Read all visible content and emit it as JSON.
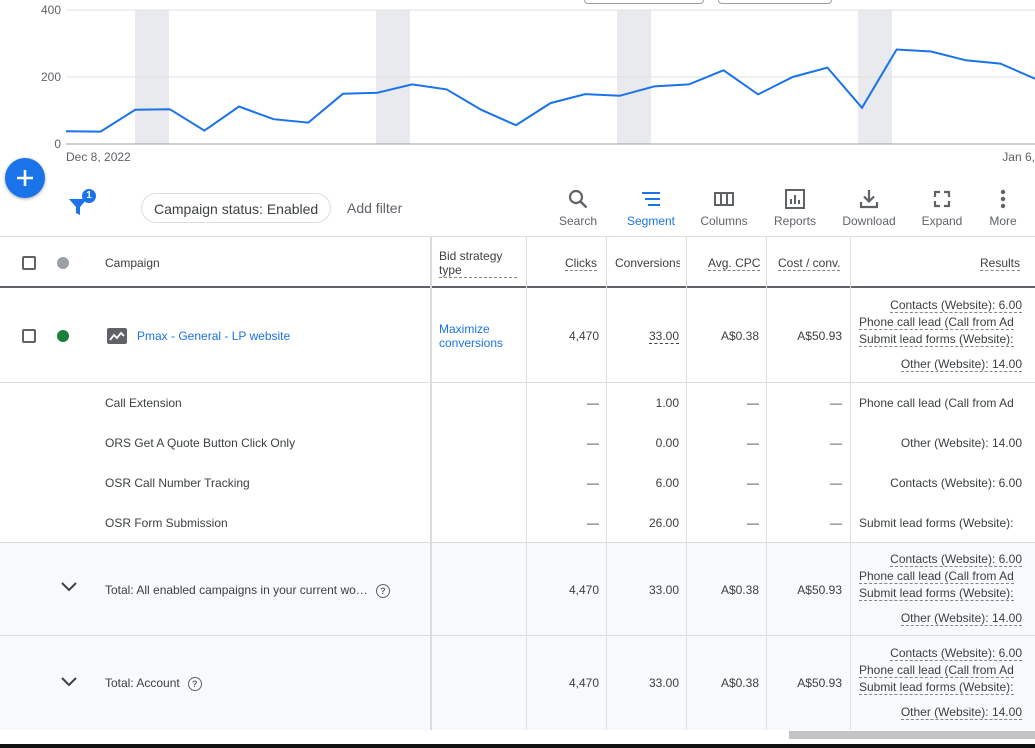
{
  "chart": {
    "y_ticks": [
      "400",
      "200",
      "0"
    ],
    "x_start_label": "Dec 8, 2022",
    "x_end_label": "Jan 6,",
    "line_color": "#1a73e8",
    "values": [
      38,
      37,
      102,
      104,
      40,
      112,
      74,
      64,
      150,
      153,
      178,
      163,
      102,
      56,
      122,
      149,
      144,
      172,
      178,
      220,
      148,
      200,
      228,
      108,
      282,
      276,
      250,
      240,
      195
    ]
  },
  "fab": {
    "icon": "plus-icon"
  },
  "toolbar": {
    "filter_badge": "1",
    "status_chip": "Campaign status: Enabled",
    "add_filter": "Add filter",
    "tools": [
      {
        "label": "Search",
        "icon": "search-icon"
      },
      {
        "label": "Segment",
        "icon": "segment-icon"
      },
      {
        "label": "Columns",
        "icon": "columns-icon"
      },
      {
        "label": "Reports",
        "icon": "reports-icon"
      },
      {
        "label": "Download",
        "icon": "download-icon"
      },
      {
        "label": "Expand",
        "icon": "expand-icon"
      },
      {
        "label": "More",
        "icon": "more-vert-icon"
      }
    ]
  },
  "table": {
    "headers": {
      "campaign": "Campaign",
      "bid_strategy_1": "Bid strategy",
      "bid_strategy_2": "type",
      "clicks": "Clicks",
      "conversions": "Conversions",
      "avg_cpc": "Avg. CPC",
      "cost_conv": "Cost / conv.",
      "results": "Results"
    },
    "campaign_row": {
      "name": "Pmax - General - LP website",
      "status_color": "#188038",
      "bid_strategy_1": "Maximize",
      "bid_strategy_2": "conversions",
      "clicks": "4,470",
      "conversions": "33.00",
      "avg_cpc": "A$0.38",
      "cost_conv": "A$50.93",
      "results": [
        "Contacts (Website): 6.00",
        "Phone call lead (Call from Ad",
        "Submit lead forms (Website):",
        "Other (Website): 14.00"
      ]
    },
    "segment_rows": [
      {
        "name": "Call Extension",
        "clicks": "—",
        "conversions": "1.00",
        "avg_cpc": "—",
        "cost_conv": "—",
        "result": "Phone call lead (Call from Ad"
      },
      {
        "name": "ORS Get A Quote Button Click Only",
        "clicks": "—",
        "conversions": "0.00",
        "avg_cpc": "—",
        "cost_conv": "—",
        "result": "Other (Website): 14.00"
      },
      {
        "name": "OSR Call Number Tracking",
        "clicks": "—",
        "conversions": "6.00",
        "avg_cpc": "—",
        "cost_conv": "—",
        "result": "Contacts (Website): 6.00"
      },
      {
        "name": "OSR Form Submission",
        "clicks": "—",
        "conversions": "26.00",
        "avg_cpc": "—",
        "cost_conv": "—",
        "result": "Submit lead forms (Website):"
      }
    ],
    "totals": [
      {
        "name": "Total: All enabled campaigns in your current wo…",
        "clicks": "4,470",
        "conversions": "33.00",
        "avg_cpc": "A$0.38",
        "cost_conv": "A$50.93",
        "results": [
          "Contacts (Website): 6.00",
          "Phone call lead (Call from Ad",
          "Submit lead forms (Website):",
          "Other (Website): 14.00"
        ]
      },
      {
        "name": "Total: Account",
        "clicks": "4,470",
        "conversions": "33.00",
        "avg_cpc": "A$0.38",
        "cost_conv": "A$50.93",
        "results": [
          "Contacts (Website): 6.00",
          "Phone call lead (Call from Ad",
          "Submit lead forms (Website):",
          "Other (Website): 14.00"
        ]
      }
    ]
  }
}
